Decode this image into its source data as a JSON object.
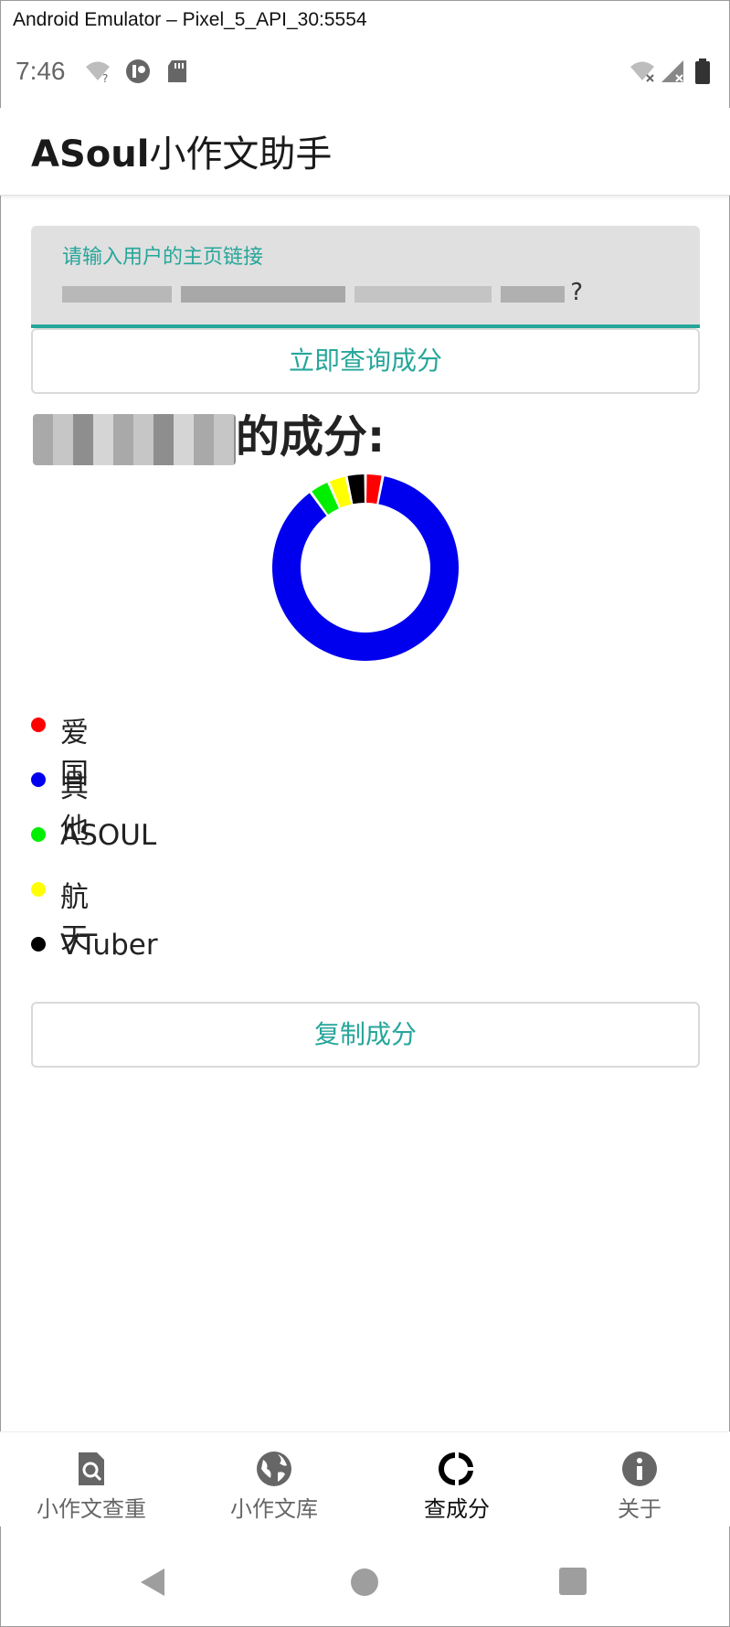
{
  "window": {
    "title": "Android Emulator – Pixel_5_API_30:5554"
  },
  "status_bar": {
    "time": "7:46",
    "colors": {
      "icon": "#666666",
      "battery": "#333333"
    }
  },
  "app_bar": {
    "title_latin": "ASoul",
    "title_cjk": "小作文助手"
  },
  "query": {
    "label": "请输入用户的主页链接",
    "value_tail": "?",
    "button_label": "立即查询成分"
  },
  "result": {
    "title_suffix": "的成分:"
  },
  "chart_data": {
    "type": "pie",
    "style": "donut",
    "title": "",
    "labels": [
      "爱国",
      "其他",
      "ASOUL",
      "航天",
      "VTuber"
    ],
    "values": [
      3,
      87,
      3.5,
      3.2,
      3.3
    ],
    "colors": [
      "#ff0000",
      "#0000ee",
      "#00ee00",
      "#ffff00",
      "#000000"
    ],
    "start": "top, clockwise",
    "legend_placement": "bottom-left"
  },
  "legend": {
    "items": [
      {
        "label": "爱国",
        "color": "#ff0000"
      },
      {
        "label": "其他",
        "color": "#0000ee"
      },
      {
        "label": "ASOUL",
        "color": "#00ee00"
      },
      {
        "label": "航天",
        "color": "#ffff00"
      },
      {
        "label": "VTuber",
        "color": "#000000"
      }
    ]
  },
  "copy_button": {
    "label": "复制成分"
  },
  "bottom_nav": {
    "items": [
      {
        "label": "小作文查重",
        "icon": "file-search-icon",
        "active": false
      },
      {
        "label": "小作文库",
        "icon": "globe-icon",
        "active": false
      },
      {
        "label": "查成分",
        "icon": "donut-chart-icon",
        "active": true
      },
      {
        "label": "关于",
        "icon": "info-icon",
        "active": false
      }
    ]
  },
  "accent_color": "#26a69a"
}
